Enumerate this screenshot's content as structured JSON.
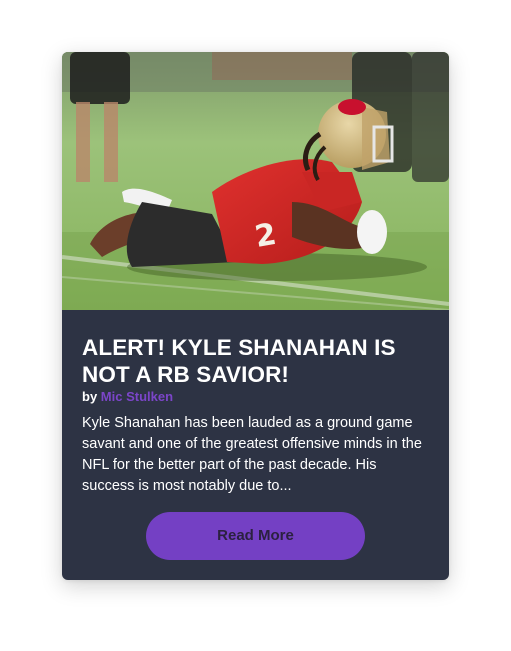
{
  "article": {
    "title": "ALERT! KYLE SHANAHAN IS NOT A RB SAVIOR!",
    "byline_prefix": "by",
    "author": "Mic Stulken",
    "excerpt": "Kyle Shanahan has been lauded as a ground game savant and one of the greatest offensive minds in the NFL for the better part of the past decade. His success is most notably due to...",
    "read_more_label": "Read More",
    "image_icon": "football-player-photo"
  },
  "colors": {
    "card_background": "#2d3344",
    "accent": "#7440c4",
    "author_link": "#7b45c9",
    "title_text": "#ffffff"
  }
}
